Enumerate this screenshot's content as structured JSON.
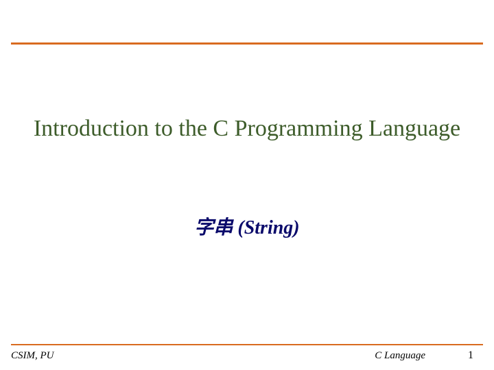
{
  "colors": {
    "top_bar": "#d96b1f",
    "title": "#3d5c2a",
    "subtitle": "#0a0a6b"
  },
  "slide": {
    "title": "Introduction to the C Programming Language",
    "subtitle": "字串 (String)"
  },
  "footer": {
    "left": "CSIM, PU",
    "center": "C Language",
    "page_number": "1"
  }
}
